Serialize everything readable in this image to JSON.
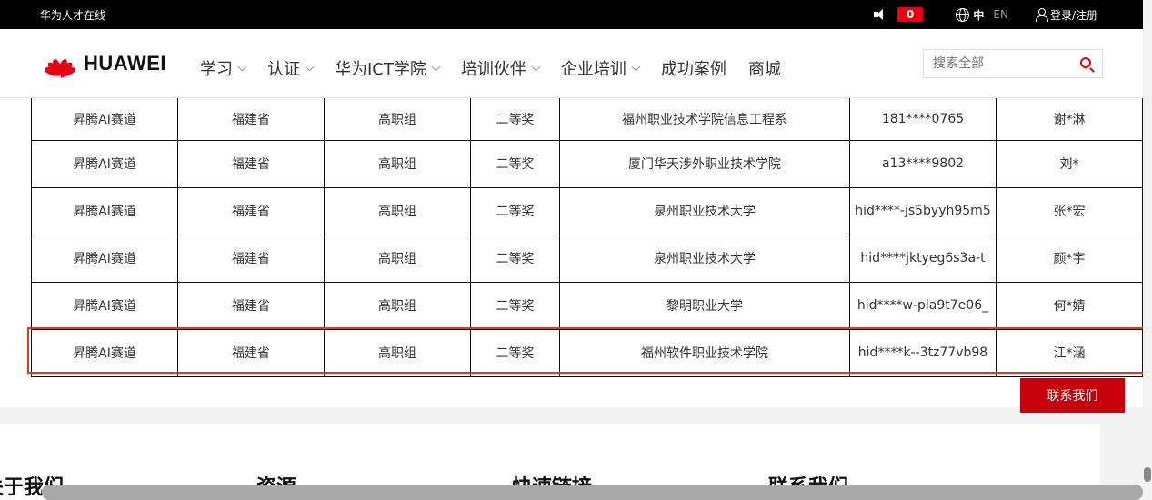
{
  "topbar": {
    "site_name": "华为人才在线",
    "notification_count": "0",
    "lang_zh": "中",
    "lang_en": "EN",
    "login": "登录/注册"
  },
  "nav": {
    "logo_text": "HUAWEI",
    "menu": [
      {
        "label": "学习",
        "has_dropdown": true
      },
      {
        "label": "认证",
        "has_dropdown": true
      },
      {
        "label": "华为ICT学院",
        "has_dropdown": true
      },
      {
        "label": "培训伙伴",
        "has_dropdown": true
      },
      {
        "label": "企业培训",
        "has_dropdown": true
      },
      {
        "label": "成功案例",
        "has_dropdown": false
      },
      {
        "label": "商城",
        "has_dropdown": false
      }
    ],
    "search_placeholder": "搜索全部"
  },
  "table": {
    "rows": [
      [
        "昇腾AI赛道",
        "福建省",
        "高职组",
        "二等奖",
        "福州职业技术学院信息工程系",
        "181****0765",
        "谢*淋"
      ],
      [
        "昇腾AI赛道",
        "福建省",
        "高职组",
        "二等奖",
        "厦门华天涉外职业技术学院",
        "a13****9802",
        "刘*"
      ],
      [
        "昇腾AI赛道",
        "福建省",
        "高职组",
        "二等奖",
        "泉州职业技术大学",
        "hid****-js5byyh95m5",
        "张*宏"
      ],
      [
        "昇腾AI赛道",
        "福建省",
        "高职组",
        "二等奖",
        "泉州职业技术大学",
        "hid****jktyeg6s3a-t",
        "颜*宇"
      ],
      [
        "昇腾AI赛道",
        "福建省",
        "高职组",
        "二等奖",
        "黎明职业大学",
        "hid****w-pla9t7e06_",
        "何*婧"
      ],
      [
        "昇腾AI赛道",
        "福建省",
        "高职组",
        "二等奖",
        "福州软件职业技术学院",
        "hid****k--3tz77vb98",
        "江*涵"
      ]
    ],
    "highlighted_row": 5
  },
  "contact_button": "联系我们",
  "footer": {
    "headings": [
      "关于我们",
      "资源",
      "快速链接",
      "联系我们"
    ]
  },
  "colors": {
    "brand_red": "#c7000b",
    "badge_red": "#e60012",
    "highlight": "#e0391f"
  }
}
